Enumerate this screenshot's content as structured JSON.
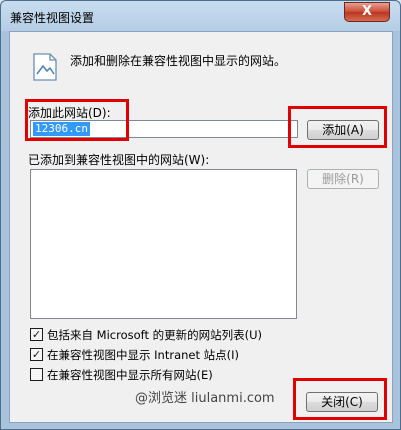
{
  "window": {
    "title": "兼容性视图设置",
    "close_glyph": "X"
  },
  "info": {
    "text": "添加和删除在兼容性视图中显示的网站。",
    "icon": "landscape-document-icon"
  },
  "add_site": {
    "label": "添加此网站(D):",
    "value": "12306.cn",
    "add_button": "添加(A)"
  },
  "list": {
    "label": "已添加到兼容性视图中的网站(W):",
    "remove_button": "删除(R)",
    "items": []
  },
  "options": [
    {
      "label": "包括来自 Microsoft 的更新的网站列表(U)",
      "checked": true,
      "mark": "✓"
    },
    {
      "label": "在兼容性视图中显示 Intranet 站点(I)",
      "checked": true,
      "mark": "✓"
    },
    {
      "label": "在兼容性视图中显示所有网站(E)",
      "checked": false,
      "mark": ""
    }
  ],
  "footer": {
    "watermark": "@浏览迷 liulanmi.com",
    "close_button": "关闭(C)"
  },
  "colors": {
    "highlight": "#e00000",
    "selection": "#3399ff"
  }
}
